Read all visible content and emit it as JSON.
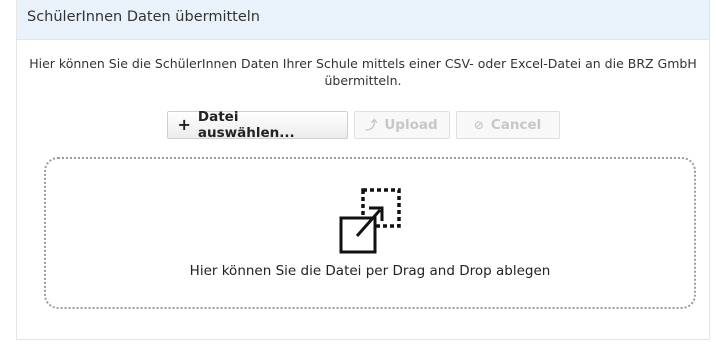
{
  "panel": {
    "title": "SchülerInnen Daten übermitteln",
    "description": "Hier können Sie die SchülerInnen Daten Ihrer Schule mittels einer CSV- oder Excel-Datei an die BRZ GmbH übermitteln."
  },
  "toolbar": {
    "add_label": "Datei auswählen...",
    "add_icon": "plus-icon",
    "upload_label": "Upload",
    "upload_icon": "upload-icon",
    "cancel_label": "Cancel",
    "cancel_icon": "cancel-icon"
  },
  "dropzone": {
    "icon": "drag-drop-icon",
    "text": "Hier können Sie die Datei per Drag and Drop ablegen"
  },
  "colors": {
    "header_background": "#e9f1fb",
    "disabled_text": "#c7c7c7"
  }
}
